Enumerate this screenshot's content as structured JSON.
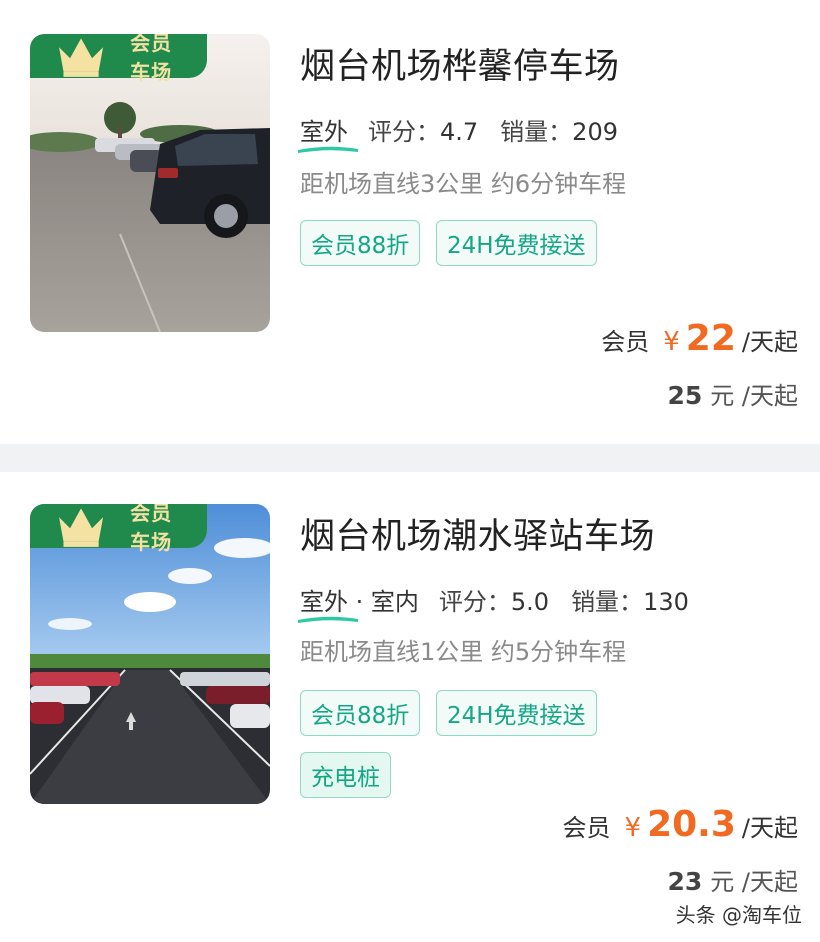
{
  "lots": [
    {
      "badge": "会员车场",
      "name": "烟台机场桦馨停车场",
      "environment": "室外",
      "rating_label": "评分：",
      "rating": "4.7",
      "sales_label": "销量：",
      "sales": "209",
      "distance": "距机场直线3公里 约6分钟车程",
      "tags": [
        "会员88折",
        "24H免费接送"
      ],
      "member_label": "会员",
      "currency": "¥",
      "member_price": "22",
      "per_day": "/天起",
      "base_price": "25",
      "base_unit": "元 /天起",
      "photo_icon": "outdoor-parking-lot-photo"
    },
    {
      "badge": "会员车场",
      "name": "烟台机场潮水驿站车场",
      "environment": "室外 · 室内",
      "rating_label": "评分：",
      "rating": "5.0",
      "sales_label": "销量：",
      "sales": "130",
      "distance": "距机场直线1公里 约5分钟车程",
      "tags": [
        "会员88折",
        "24H免费接送",
        "充电桩"
      ],
      "member_label": "会员",
      "currency": "¥",
      "member_price": "20.3",
      "per_day": "/天起",
      "base_price": "23",
      "base_unit": "元 /天起",
      "photo_icon": "parking-lane-photo"
    }
  ],
  "watermark": "头条 @淘车位",
  "colors": {
    "accent_orange": "#f06a22",
    "tag_green": "#14a785",
    "badge_green": "#1f8a4c",
    "badge_text": "#f3e2a2"
  }
}
